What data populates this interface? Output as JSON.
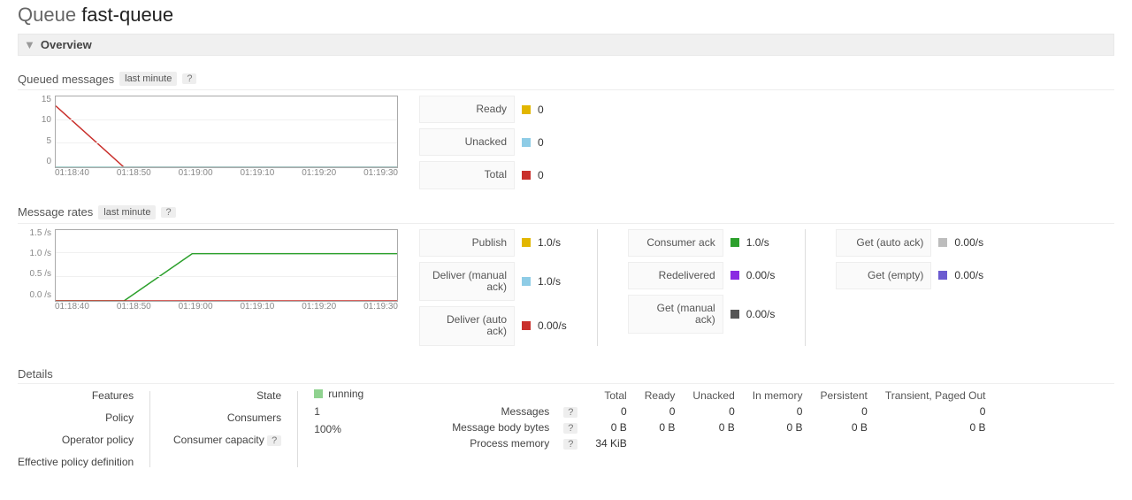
{
  "title_prefix": "Queue",
  "queue_name": "fast-queue",
  "overview_label": "Overview",
  "queued": {
    "heading": "Queued messages",
    "range": "last minute",
    "legend": {
      "ready": {
        "label": "Ready",
        "value": "0",
        "color": "#e2b600"
      },
      "unacked": {
        "label": "Unacked",
        "value": "0",
        "color": "#8ecce6"
      },
      "total": {
        "label": "Total",
        "value": "0",
        "color": "#c9302c"
      }
    }
  },
  "rates": {
    "heading": "Message rates",
    "range": "last minute",
    "legend": [
      {
        "label": "Publish",
        "value": "1.0/s",
        "color": "#e2b600"
      },
      {
        "label": "Deliver (manual ack)",
        "value": "1.0/s",
        "color": "#8ecce6"
      },
      {
        "label": "Deliver (auto ack)",
        "value": "0.00/s",
        "color": "#c9302c"
      },
      {
        "label": "Consumer ack",
        "value": "1.0/s",
        "color": "#2ca02c"
      },
      {
        "label": "Redelivered",
        "value": "0.00/s",
        "color": "#8a2be2"
      },
      {
        "label": "Get (manual ack)",
        "value": "0.00/s",
        "color": "#555555"
      },
      {
        "label": "Get (auto ack)",
        "value": "0.00/s",
        "color": "#bdbdbd"
      },
      {
        "label": "Get (empty)",
        "value": "0.00/s",
        "color": "#6b5bd0"
      }
    ]
  },
  "chart_data": [
    {
      "type": "line",
      "title": "Queued messages",
      "xlabel": "",
      "ylabel": "",
      "x": [
        "01:18:40",
        "01:18:50",
        "01:19:00",
        "01:19:10",
        "01:19:20",
        "01:19:30"
      ],
      "ylim": [
        0,
        15
      ],
      "yticks": [
        0,
        5,
        10,
        15
      ],
      "series": [
        {
          "name": "Total",
          "color": "#c9302c",
          "values": [
            13,
            0,
            0,
            0,
            0,
            0
          ]
        },
        {
          "name": "Ready",
          "color": "#e2b600",
          "values": [
            0,
            0,
            0,
            0,
            0,
            0
          ]
        },
        {
          "name": "Unacked",
          "color": "#8ecce6",
          "values": [
            0,
            0,
            0,
            0,
            0,
            0
          ]
        }
      ]
    },
    {
      "type": "line",
      "title": "Message rates",
      "xlabel": "",
      "ylabel": "/s",
      "x": [
        "01:18:40",
        "01:18:50",
        "01:19:00",
        "01:19:10",
        "01:19:20",
        "01:19:30"
      ],
      "ylim": [
        0.0,
        1.5
      ],
      "yticks": [
        0.0,
        0.5,
        1.0,
        1.5
      ],
      "series": [
        {
          "name": "Publish",
          "color": "#2ca02c",
          "values": [
            0.0,
            0.0,
            1.0,
            1.0,
            1.0,
            1.0
          ]
        },
        {
          "name": "Deliver (auto ack)",
          "color": "#c9302c",
          "values": [
            0.0,
            0.0,
            0.0,
            0.0,
            0.0,
            0.0
          ]
        }
      ]
    }
  ],
  "details": {
    "heading": "Details",
    "left_labels": [
      "Features",
      "Policy",
      "Operator policy",
      "Effective policy definition"
    ],
    "mid": {
      "state_label": "State",
      "state_value": "running",
      "state_color": "#8fd28f",
      "consumers_label": "Consumers",
      "consumers_value": "1",
      "capacity_label": "Consumer capacity",
      "capacity_value": "100%"
    },
    "table": {
      "columns": [
        "Total",
        "Ready",
        "Unacked",
        "In memory",
        "Persistent",
        "Transient, Paged Out"
      ],
      "rows": [
        {
          "label": "Messages",
          "cells": [
            "0",
            "0",
            "0",
            "0",
            "0",
            "0"
          ]
        },
        {
          "label": "Message body bytes",
          "cells": [
            "0 B",
            "0 B",
            "0 B",
            "0 B",
            "0 B",
            "0 B"
          ]
        },
        {
          "label": "Process memory",
          "cells": [
            "34 KiB",
            "",
            "",
            "",
            "",
            ""
          ]
        }
      ]
    }
  }
}
